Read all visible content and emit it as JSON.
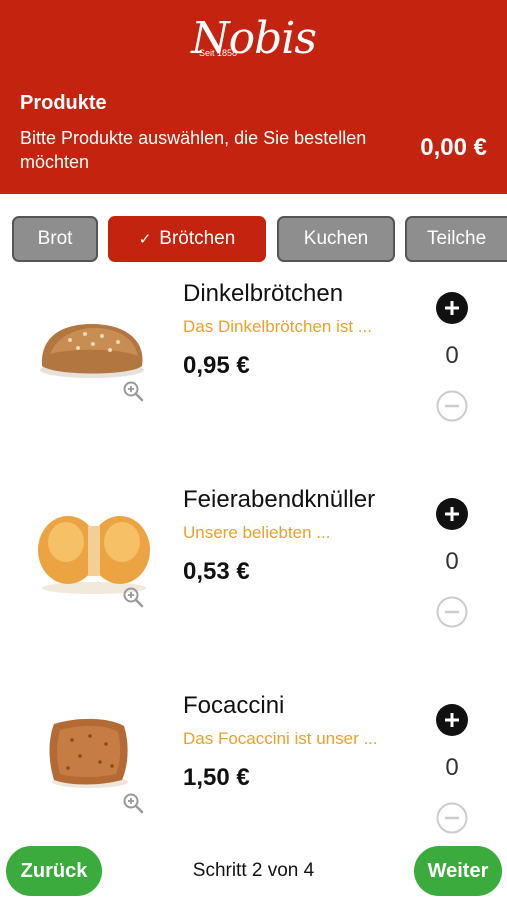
{
  "brand": {
    "name": "Nobis",
    "tagline": "Seit 1858"
  },
  "header": {
    "title": "Produkte",
    "subtitle": "Bitte Produkte auswählen, die Sie bestellen möchten",
    "total": "0,00 €",
    "background_color": "#c4230f"
  },
  "tabs": [
    {
      "label": "Brot",
      "active": false
    },
    {
      "label": "Brötchen",
      "active": true,
      "icon": "check-icon"
    },
    {
      "label": "Kuchen",
      "active": false
    },
    {
      "label": "Teilche",
      "active": false
    }
  ],
  "products": [
    {
      "name": "Dinkelbrötchen",
      "description": "Das Dinkelbrötchen ist ...",
      "price": "0,95 €",
      "quantity": "0",
      "image_icon": "bread-roll-image"
    },
    {
      "name": "Feierabendknüller",
      "description": "Unsere beliebten ...",
      "price": "0,53 €",
      "quantity": "0",
      "image_icon": "double-roll-image"
    },
    {
      "name": "Focaccini",
      "description": "Das Focaccini ist unser ...",
      "price": "1,50 €",
      "quantity": "0",
      "image_icon": "focaccini-image"
    }
  ],
  "footer": {
    "back_label": "Zurück",
    "step_text": "Schritt 2 von 4",
    "next_label": "Weiter",
    "button_color": "#3bab3d"
  },
  "colors": {
    "accent": "#c4230f",
    "description": "#e8a12a",
    "tab_inactive": "#8e8e8e"
  }
}
